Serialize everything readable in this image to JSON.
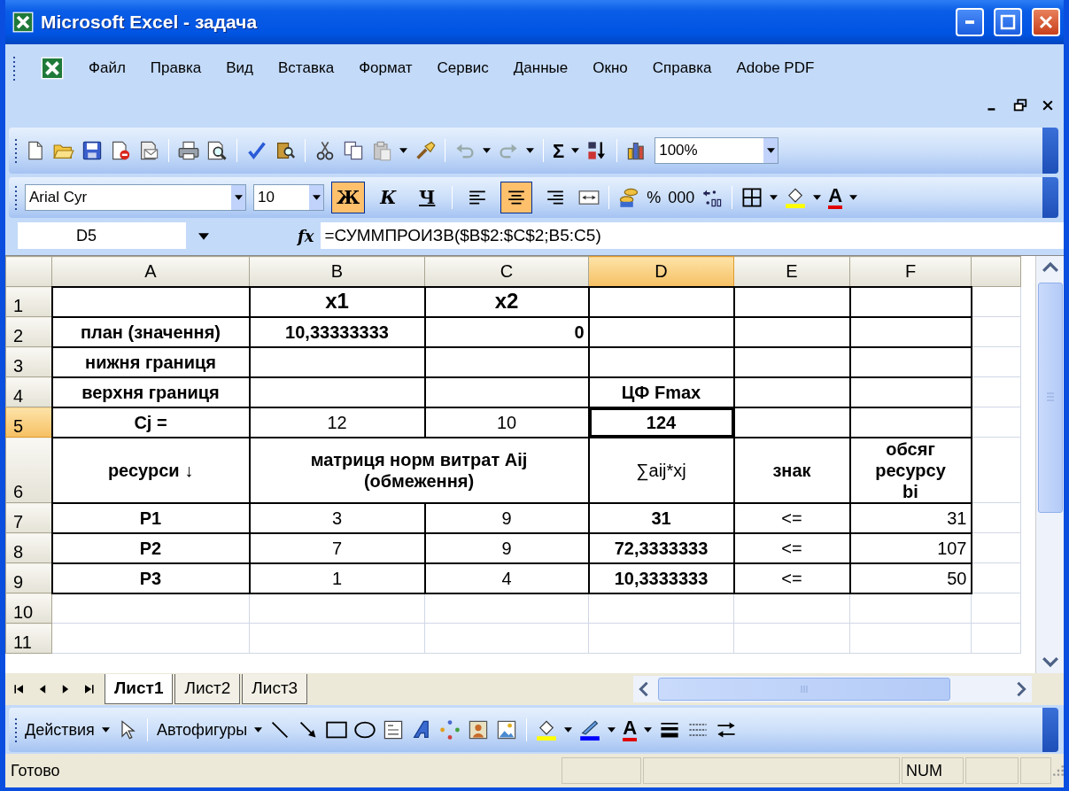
{
  "window": {
    "title": "Microsoft Excel - задача"
  },
  "menu": [
    "Файл",
    "Правка",
    "Вид",
    "Вставка",
    "Формат",
    "Сервис",
    "Данные",
    "Окно",
    "Справка",
    "Adobe PDF"
  ],
  "standard_toolbar": {
    "autosum": "Σ",
    "zoom": "100%"
  },
  "formatting_toolbar": {
    "font": "Arial Cyr",
    "size": "10",
    "styles": [
      {
        "kind": "bold",
        "label": "Ж",
        "selected": true
      },
      {
        "kind": "italic",
        "label": "К",
        "selected": false
      },
      {
        "kind": "underline",
        "label": "Ч",
        "selected": false
      }
    ],
    "alignment": [
      {
        "kind": "left",
        "selected": false
      },
      {
        "kind": "center",
        "selected": true
      },
      {
        "kind": "right",
        "selected": false
      }
    ],
    "percent": "%",
    "thousands": "000",
    "font_color": "A"
  },
  "formula_bar": {
    "name_box": "D5",
    "fx": "fx",
    "formula": "=СУММПРОИЗВ($B$2:$C$2;B5:C5)"
  },
  "sheet": {
    "columns": [
      {
        "label": "A",
        "selected": false
      },
      {
        "label": "B",
        "selected": false
      },
      {
        "label": "C",
        "selected": false
      },
      {
        "label": "D",
        "selected": true
      },
      {
        "label": "E",
        "selected": false
      },
      {
        "label": "F",
        "selected": false
      }
    ],
    "rows": [
      {
        "header": "1",
        "selected": false,
        "bordered": true,
        "cells": [
          null,
          {
            "text": "x1",
            "kind": "header"
          },
          {
            "text": "x2",
            "kind": "header"
          },
          null,
          null,
          null
        ]
      },
      {
        "header": "2",
        "selected": false,
        "bordered": true,
        "cells": [
          {
            "text": "план (значення)",
            "kind": "label"
          },
          {
            "text": "10,33333333",
            "kind": "result"
          },
          {
            "text": "0",
            "kind": "figure"
          },
          null,
          null,
          null
        ]
      },
      {
        "header": "3",
        "selected": false,
        "bordered": true,
        "cells": [
          {
            "text": "нижня границя",
            "kind": "label"
          },
          null,
          null,
          null,
          null,
          null
        ]
      },
      {
        "header": "4",
        "selected": false,
        "bordered": true,
        "cells": [
          {
            "text": "верхня границя",
            "kind": "label"
          },
          null,
          null,
          {
            "text": "ЦФ Fmax",
            "kind": "label"
          },
          null,
          null
        ]
      },
      {
        "header": "5",
        "selected": true,
        "bordered": true,
        "cells": [
          {
            "text": "Cj =",
            "kind": "label"
          },
          {
            "text": "12",
            "kind": "value"
          },
          {
            "text": "10",
            "kind": "value"
          },
          {
            "text": "124",
            "kind": "result"
          },
          null,
          null
        ]
      },
      {
        "header": "6",
        "selected": false,
        "bordered": true,
        "cells": [
          {
            "text": "ресурси ↓",
            "kind": "label"
          },
          {
            "text": "матриця норм витрат Aij\n(обмеження)",
            "kind": "label",
            "colspan": 2
          },
          {
            "text": "∑aij*xj",
            "kind": "value"
          },
          {
            "text": "знак",
            "kind": "label"
          },
          {
            "text": "обсяг\nресурсу\nbi",
            "kind": "label"
          }
        ]
      },
      {
        "header": "7",
        "selected": false,
        "bordered": true,
        "cells": [
          {
            "text": "P1",
            "kind": "label"
          },
          {
            "text": "3",
            "kind": "value"
          },
          {
            "text": "9",
            "kind": "value"
          },
          {
            "text": "31",
            "kind": "result"
          },
          {
            "text": "<=",
            "kind": "value"
          },
          {
            "text": "31",
            "kind": "amount"
          }
        ]
      },
      {
        "header": "8",
        "selected": false,
        "bordered": true,
        "cells": [
          {
            "text": "P2",
            "kind": "label"
          },
          {
            "text": "7",
            "kind": "value"
          },
          {
            "text": "9",
            "kind": "value"
          },
          {
            "text": "72,3333333",
            "kind": "result"
          },
          {
            "text": "<=",
            "kind": "value"
          },
          {
            "text": "107",
            "kind": "amount"
          }
        ]
      },
      {
        "header": "9",
        "selected": false,
        "bordered": true,
        "cells": [
          {
            "text": "P3",
            "kind": "label"
          },
          {
            "text": "1",
            "kind": "value"
          },
          {
            "text": "4",
            "kind": "value"
          },
          {
            "text": "10,3333333",
            "kind": "result"
          },
          {
            "text": "<=",
            "kind": "value"
          },
          {
            "text": "50",
            "kind": "amount"
          }
        ]
      },
      {
        "header": "10",
        "selected": false,
        "bordered": false,
        "cells": [
          null,
          null,
          null,
          null,
          null,
          null
        ]
      },
      {
        "header": "11",
        "selected": false,
        "bordered": false,
        "cells": [
          null,
          null,
          null,
          null,
          null,
          null
        ]
      }
    ]
  },
  "sheet_tabs": [
    {
      "label": "Лист1",
      "selected": true
    },
    {
      "label": "Лист2",
      "selected": false
    },
    {
      "label": "Лист3",
      "selected": false
    }
  ],
  "drawing_toolbar": {
    "actions": "Действия",
    "autoshapes": "Автофигуры",
    "font_color": "A"
  },
  "status_bar": {
    "text": "Готово",
    "indicator": "NUM"
  }
}
